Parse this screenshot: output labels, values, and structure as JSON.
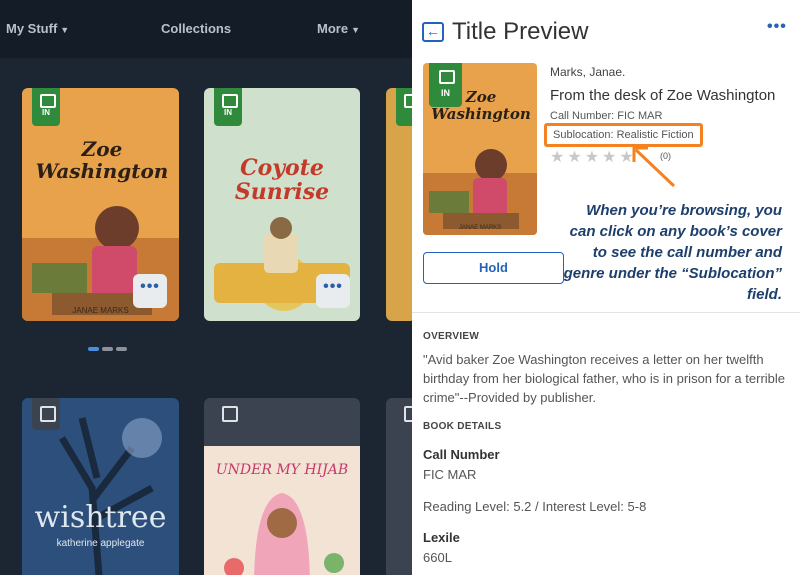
{
  "nav": {
    "my_stuff": "My Stuff",
    "collections": "Collections",
    "more": "More"
  },
  "grid": {
    "book1": {
      "badge": "IN",
      "title_art": "Zoe Washington",
      "author_art": "JANAE MARKS",
      "more_label": "•••"
    },
    "book2": {
      "badge": "IN",
      "title_art": "Coyote Sunrise",
      "more_label": "•••"
    },
    "book4": {
      "title_art": "wishtree",
      "author_art": "katherine applegate"
    },
    "book5": {
      "title_art": "UNDER MY HIJAB"
    }
  },
  "panel": {
    "back_label": "←",
    "title": "Title Preview",
    "more_label": "•••",
    "cover_badge": "IN",
    "author": "Marks, Janae.",
    "book_title": "From the desk of Zoe Washington",
    "call_number_line": "Call Number: FIC MAR",
    "sublocation": "Sublocation: Realistic Fiction",
    "stars": "★★★★★",
    "rating_count": "(0)",
    "callout": "When you’re browsing, you can click on any book’s cover to see the call number and genre under the “Sublocation” field.",
    "hold_label": "Hold",
    "overview_heading": "OVERVIEW",
    "overview_text": "\"Avid baker Zoe Washington receives a letter on her twelfth birthday from her biological father, who is in prison for a terrible crime\"--Provided by publisher.",
    "details_heading": "BOOK DETAILS",
    "call_number_label": "Call Number",
    "call_number_value": "FIC MAR",
    "reading_level": "Reading Level: 5.2 / Interest Level: 5-8",
    "lexile_label": "Lexile",
    "lexile_value": "660L"
  },
  "colors": {
    "accent": "#2563b8",
    "callout_border": "#f58220",
    "available_badge": "#2f8a3c",
    "background_dark": "#1c2532"
  }
}
